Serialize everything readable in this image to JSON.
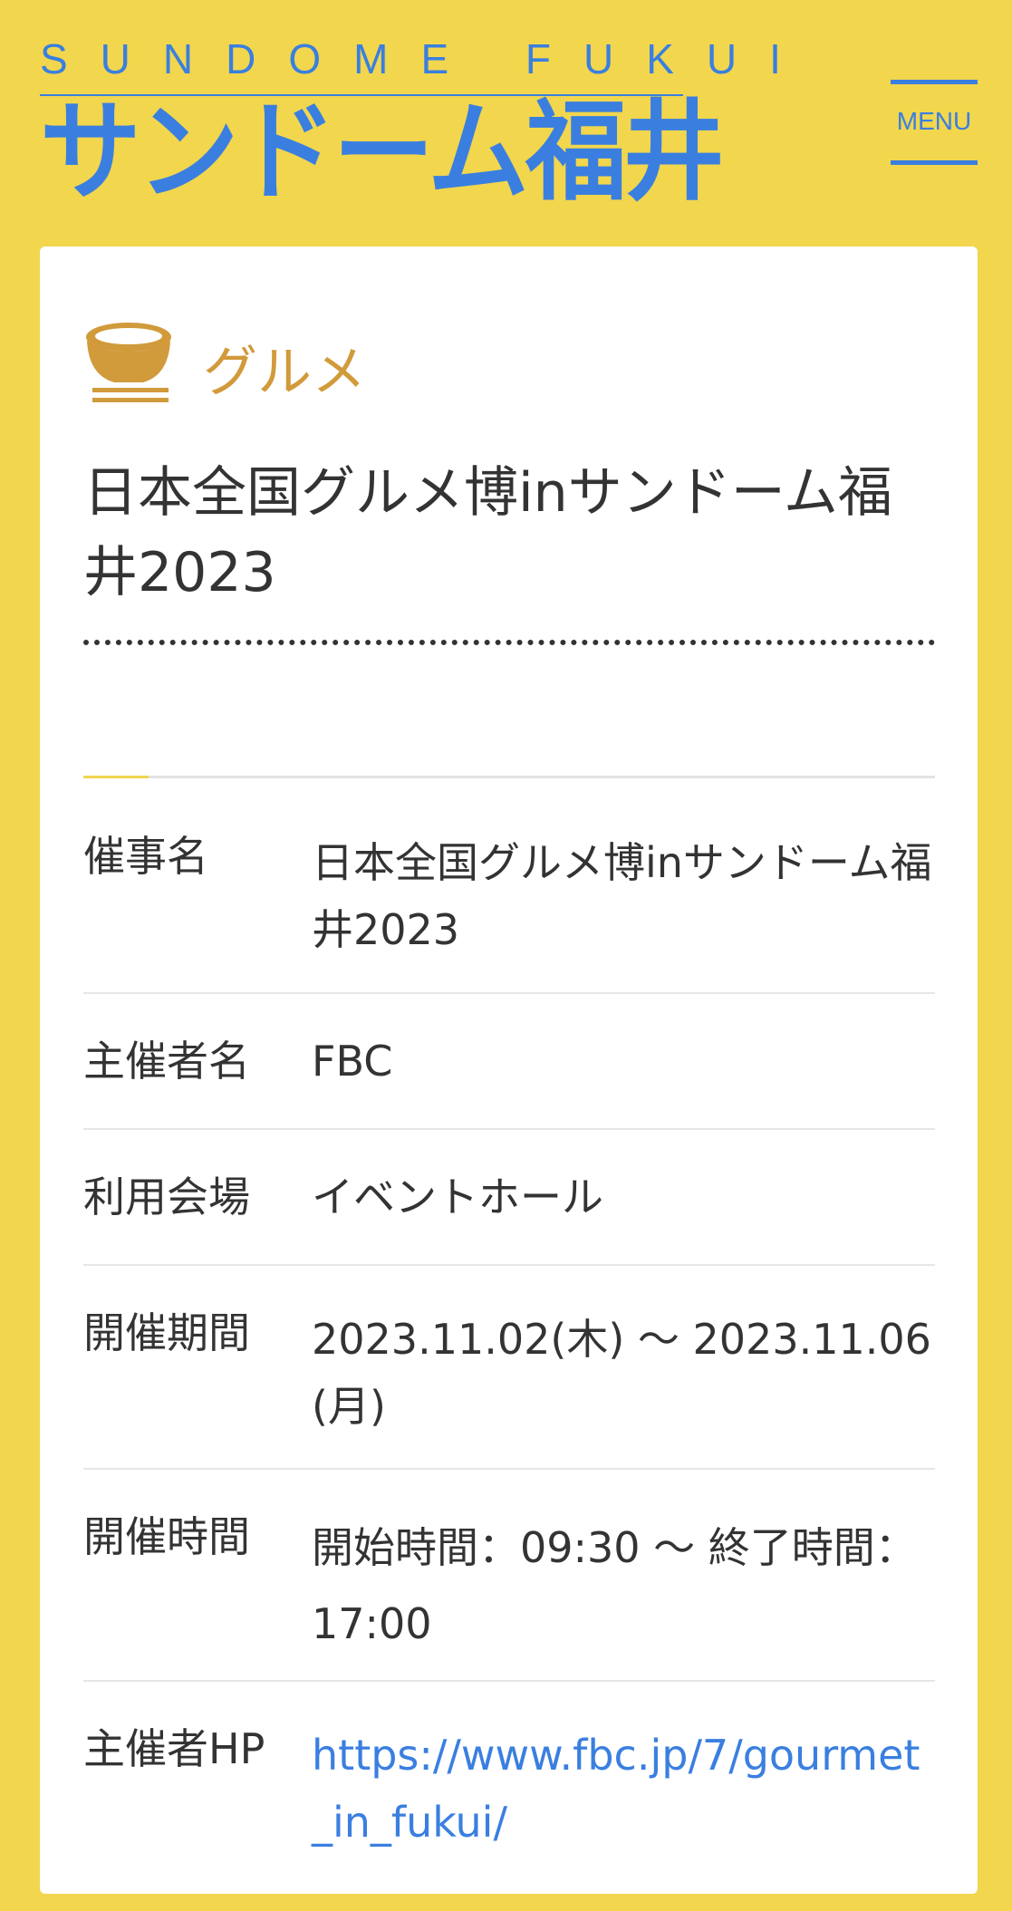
{
  "header": {
    "logo_en": "SUNDOME FUKUI",
    "logo_jp": "サンドーム福井",
    "menu_label": "MENU"
  },
  "category": {
    "icon": "bowl-icon",
    "label": "グルメ"
  },
  "event": {
    "title": "日本全国グルメ博inサンドーム福井2023"
  },
  "info": [
    {
      "key": "催事名",
      "value": "日本全国グルメ博inサンドーム福井2023"
    },
    {
      "key": "主催者名",
      "value": "FBC"
    },
    {
      "key": "利用会場",
      "value": "イベントホール"
    },
    {
      "key": "開催期間",
      "value": "2023.11.02(木) 〜 2023.11.06(月)"
    },
    {
      "key": "開催時間",
      "value": "開始時間：09:30 〜 終了時間：17:00"
    },
    {
      "key": "主催者HP",
      "value": "https://www.fbc.jp/7/gourmet_in_fukui/"
    }
  ],
  "colors": {
    "background": "#f1d64e",
    "accent_blue": "#3a7fe0",
    "category_gold": "#d19a3b"
  }
}
